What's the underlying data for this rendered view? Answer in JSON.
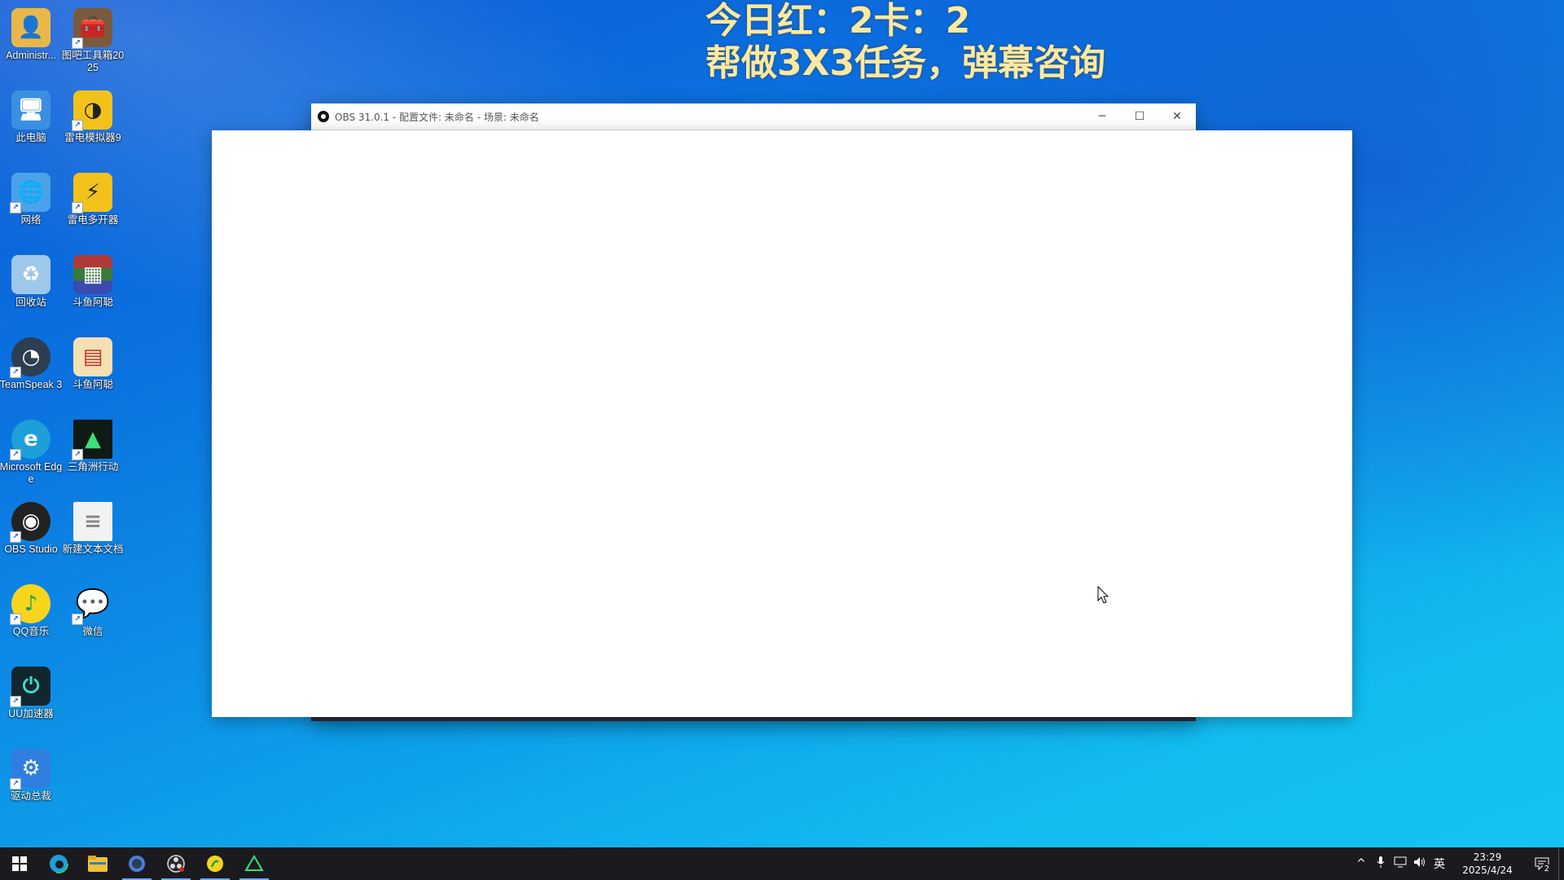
{
  "overlay": {
    "line1": "今日红：2卡：2",
    "line2": "帮做3X3任务，弹幕咨询"
  },
  "desktop_icons": [
    {
      "label": "Administr...",
      "icon": "user-folder-icon",
      "color": "#e9b84a"
    },
    {
      "label": "图吧工具箱2025",
      "icon": "toolbox-icon",
      "color": "#7a5a3c"
    },
    {
      "label": "此电脑",
      "icon": "computer-icon",
      "color": "#3a8fe0"
    },
    {
      "label": "雷电模拟器9",
      "icon": "ldplayer-icon",
      "color": "#f3c21a"
    },
    {
      "label": "网络",
      "icon": "network-icon",
      "color": "#4aa3e8"
    },
    {
      "label": "雷电多开器",
      "icon": "ld-multi-icon",
      "color": "#f3c21a"
    },
    {
      "label": "回收站",
      "icon": "recycle-bin-icon",
      "color": "#9ec8ea"
    },
    {
      "label": "斗鱼阿聪",
      "icon": "winrar-icon",
      "color": "#b03a3a"
    },
    {
      "label": "TeamSpeak 3",
      "icon": "teamspeak-icon",
      "color": "#2c3e50"
    },
    {
      "label": "斗鱼阿聪",
      "icon": "document-icon",
      "color": "#f4e0b0"
    },
    {
      "label": "Microsoft Edge",
      "icon": "edge-icon",
      "color": "#1d9fd8"
    },
    {
      "label": "三角洲行动",
      "icon": "delta-force-icon",
      "color": "#0e1a14"
    },
    {
      "label": "OBS Studio",
      "icon": "obs-icon",
      "color": "#222"
    },
    {
      "label": "新建文本文档",
      "icon": "text-file-icon",
      "color": "#f2f2f2"
    },
    {
      "label": "QQ音乐",
      "icon": "qq-music-icon",
      "color": "#f7d51d"
    },
    {
      "label": "微信",
      "icon": "wechat-icon",
      "color": "#ffffff"
    },
    {
      "label": "UU加速器",
      "icon": "uu-accelerator-icon",
      "color": "#12262e"
    },
    {
      "label": "驱动总裁",
      "icon": "driver-icon",
      "color": "#2f7fe0"
    }
  ],
  "obs": {
    "title": "OBS 31.0.1 - 配置文件: 未命名 - 场景: 未命名",
    "minimize": "─",
    "maximize": "☐",
    "close": "✕"
  },
  "taskbar": {
    "items": [
      {
        "icon": "windows-start-icon",
        "glyph": "⊞"
      },
      {
        "icon": "edge-icon",
        "glyph": "◍"
      },
      {
        "icon": "file-explorer-icon",
        "glyph": "▰"
      },
      {
        "icon": "teamspeak-icon",
        "glyph": "●"
      },
      {
        "icon": "obs-icon",
        "glyph": "◉"
      },
      {
        "icon": "qq-music-icon",
        "glyph": "♪"
      },
      {
        "icon": "delta-force-icon",
        "glyph": "▲"
      }
    ],
    "tray": {
      "chevron": "^",
      "mic": "🎤",
      "network": "▭",
      "volume": "🔊",
      "ime": "英",
      "time": "23:29",
      "date": "2025/4/24",
      "notifications_count": "2"
    }
  },
  "colors": {
    "overlay_text": "#fbe9a0",
    "taskbar_bg": "#1b1b1f",
    "accent": "#6ea8ff"
  }
}
